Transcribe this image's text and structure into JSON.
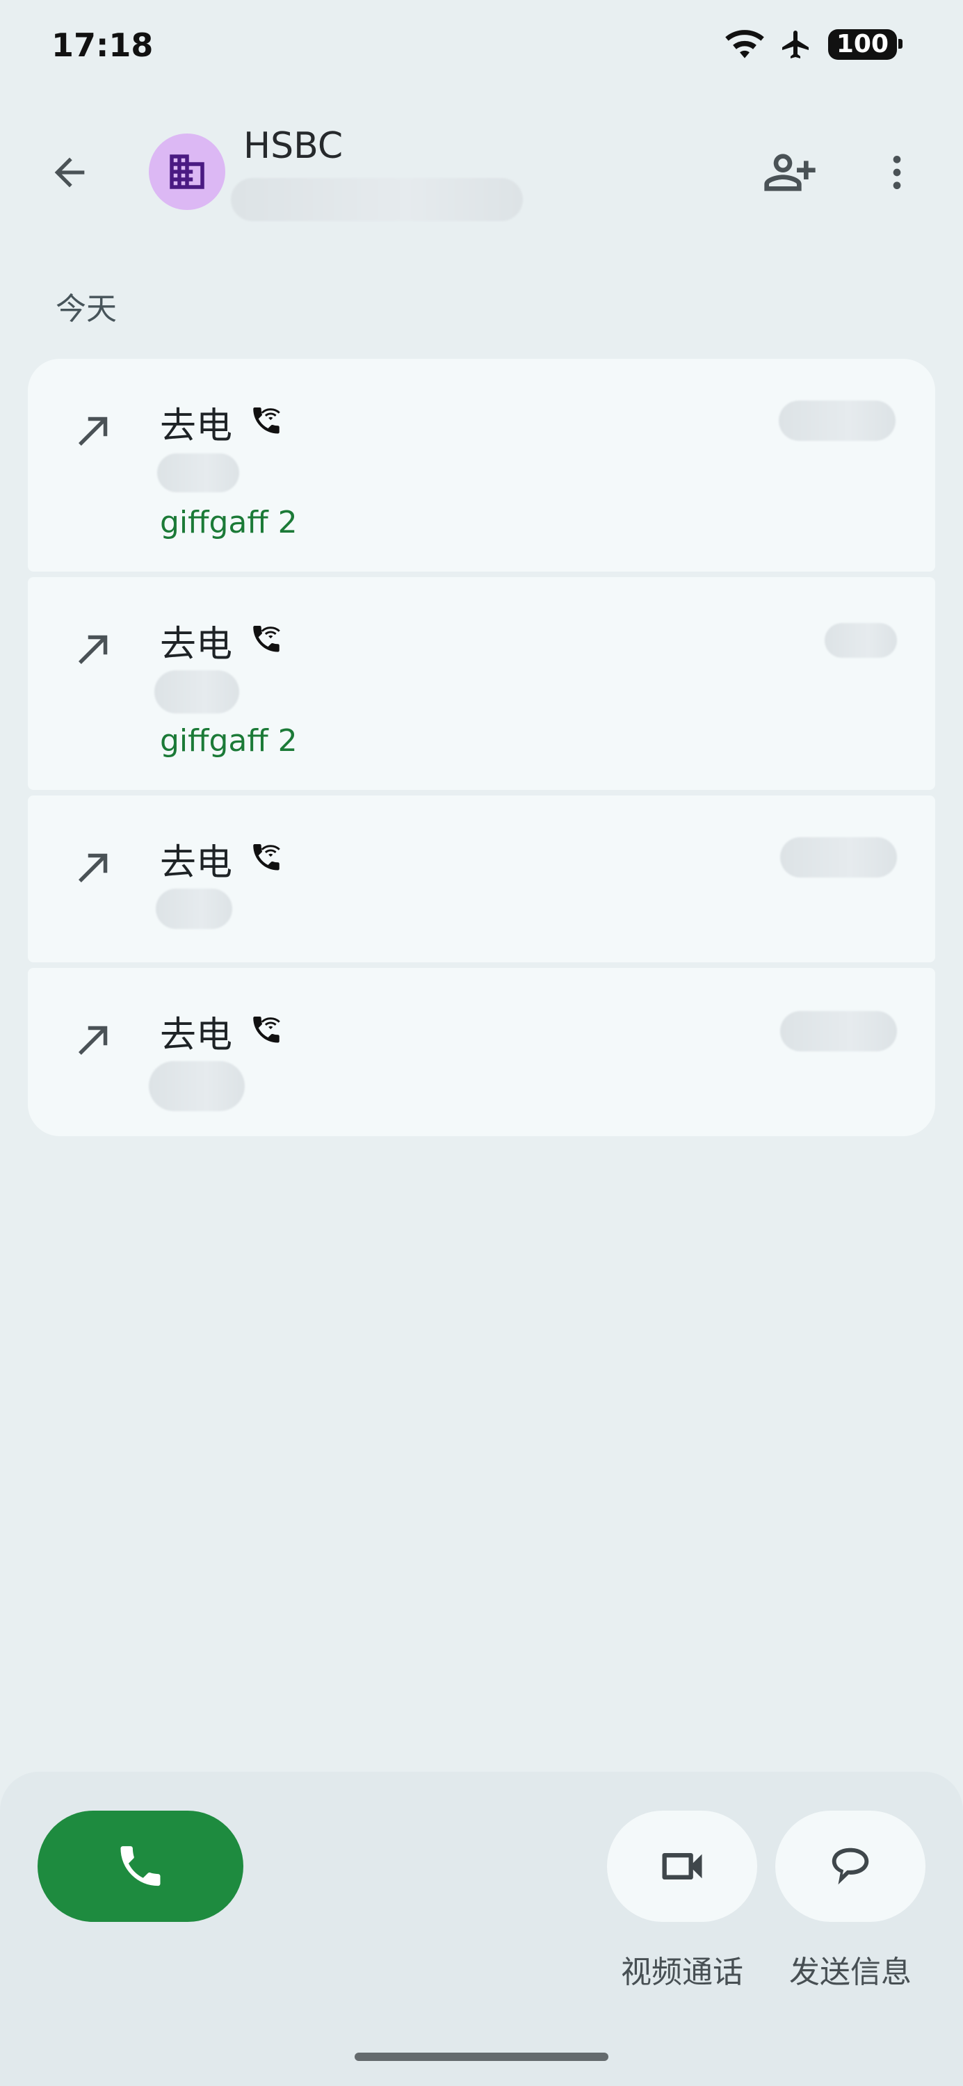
{
  "status_bar": {
    "time": "17:18",
    "battery": "100"
  },
  "header": {
    "contact_name": "HSBC"
  },
  "section_header": "今天",
  "calls": [
    {
      "type": "去电",
      "sim": "giffgaff 2"
    },
    {
      "type": "去电",
      "sim": "giffgaff 2"
    },
    {
      "type": "去电"
    },
    {
      "type": "去电"
    }
  ],
  "actions": {
    "video_call_label": "视频通话",
    "message_label": "发送信息"
  },
  "colors": {
    "background": "#e8eff1",
    "card": "#f4f9fa",
    "call_button": "#1e8b3f",
    "sim_label": "#1b7a37",
    "avatar": "#dcb8f4",
    "avatar_icon": "#4a1a82"
  },
  "icons": {
    "back": "back-arrow-icon",
    "add_contact": "add-contact-icon",
    "more": "more-vert-icon",
    "outgoing": "outgoing-call-arrow-icon",
    "wifi_call": "wifi-calling-icon",
    "phone": "phone-icon",
    "video": "videocam-icon",
    "message": "message-icon"
  }
}
